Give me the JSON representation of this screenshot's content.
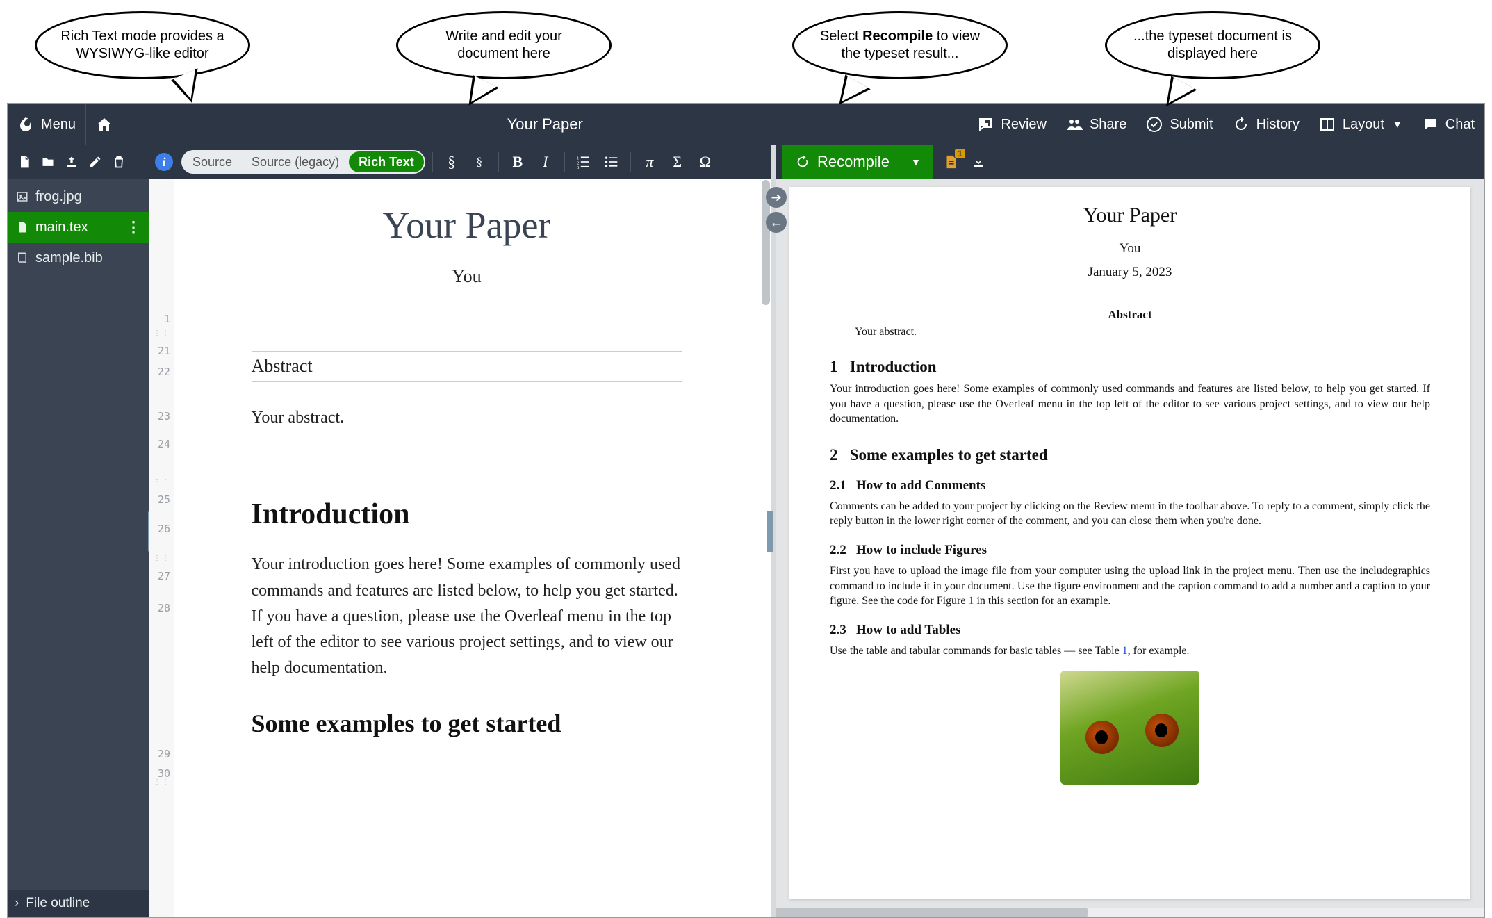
{
  "callouts": {
    "c1": "Rich Text mode provides a WYSIWYG-like editor",
    "c2": "Write and edit your document here",
    "c3_a": "Select ",
    "c3_b": "Recompile",
    "c3_c": " to view the typeset result...",
    "c4": "...the typeset document is displayed here"
  },
  "menubar": {
    "menu": "Menu",
    "project_title": "Your Paper",
    "review": "Review",
    "share": "Share",
    "submit": "Submit",
    "history": "History",
    "layout": "Layout",
    "chat": "Chat"
  },
  "files": {
    "items": [
      {
        "name": "frog.jpg",
        "active": false,
        "icon": "image"
      },
      {
        "name": "main.tex",
        "active": true,
        "icon": "file"
      },
      {
        "name": "sample.bib",
        "active": false,
        "icon": "book"
      }
    ],
    "outline": "File outline"
  },
  "editor": {
    "modes": {
      "source": "Source",
      "legacy": "Source (legacy)",
      "rich": "Rich Text"
    },
    "line_numbers": [
      "1",
      "21",
      "22",
      "23",
      "24",
      "25",
      "26",
      "27",
      "28",
      "29",
      "30"
    ],
    "doc": {
      "title": "Your Paper",
      "author": "You",
      "abstract_label": "Abstract",
      "abstract_text": "Your abstract.",
      "h1": "Introduction",
      "intro": "Your introduction goes here! Some examples of commonly used commands and features are listed below, to help you get started. If you have a question, please use the Overleaf menu in the top left of the editor to see various project settings, and to view our help documentation.",
      "h2": "Some examples to get started"
    }
  },
  "pdf": {
    "recompile": "Recompile",
    "logs_count": "1",
    "title": "Your Paper",
    "author": "You",
    "date": "January 5, 2023",
    "abstract_label": "Abstract",
    "abstract_text": "Your abstract.",
    "s1_num": "1",
    "s1_title": "Introduction",
    "s1_body": "Your introduction goes here! Some examples of commonly used commands and features are listed below, to help you get started. If you have a question, please use the Overleaf menu in the top left of the editor to see various project settings, and to view our help documentation.",
    "s2_num": "2",
    "s2_title": "Some examples to get started",
    "s21_num": "2.1",
    "s21_title": "How to add Comments",
    "s21_body": "Comments can be added to your project by clicking on the Review menu in the toolbar above. To reply to a comment, simply click the reply button in the lower right corner of the comment, and you can close them when you're done.",
    "s22_num": "2.2",
    "s22_title": "How to include Figures",
    "s22_body_a": "First you have to upload the image file from your computer using the upload link in the project menu. Then use the includegraphics command to include it in your document. Use the figure environment and the caption command to add a number and a caption to your figure. See the code for Figure ",
    "s22_link": "1",
    "s22_body_b": " in this section for an example.",
    "s23_num": "2.3",
    "s23_title": "How to add Tables",
    "s23_body_a": "Use the table and tabular commands for basic tables — see Table ",
    "s23_link": "1",
    "s23_body_b": ", for example."
  }
}
